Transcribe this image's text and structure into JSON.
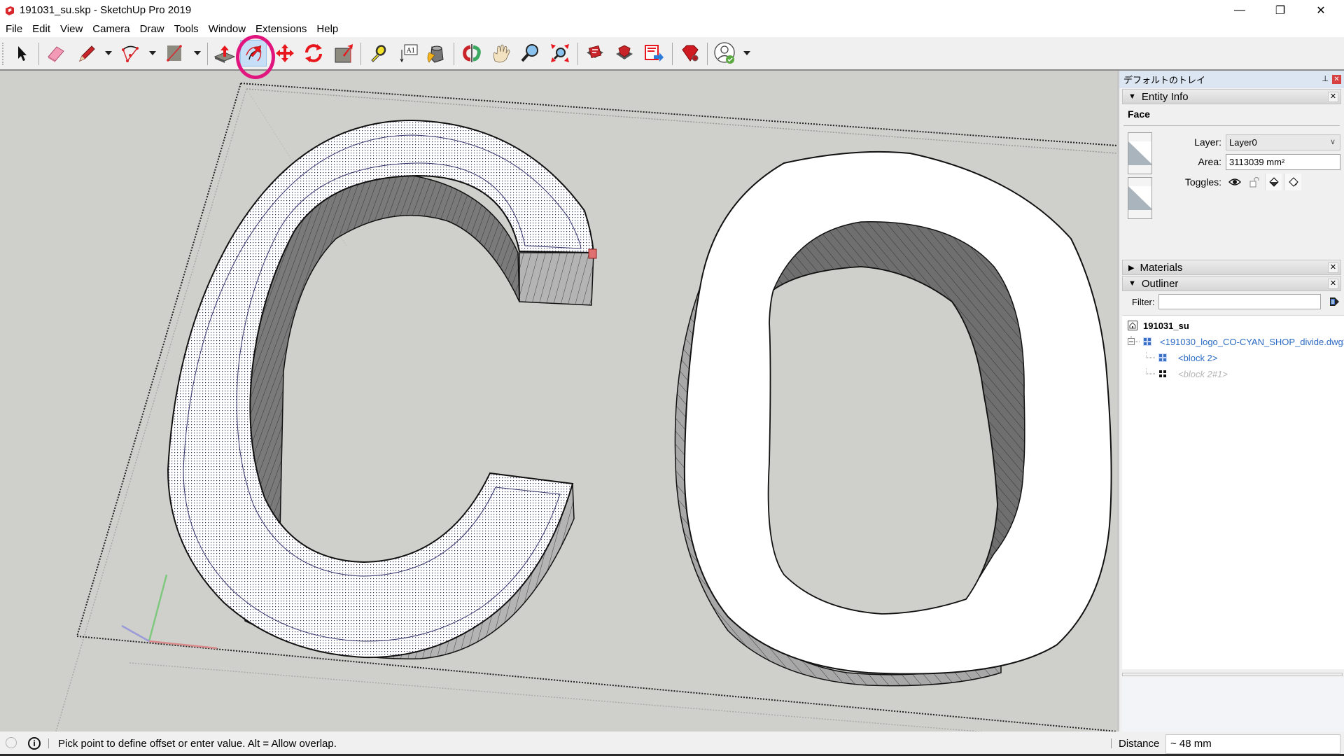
{
  "window": {
    "title": "191031_su.skp - SketchUp Pro 2019",
    "app_icon": "sketchup-logo-icon",
    "controls": {
      "minimize": "—",
      "restore": "❐",
      "close": "✕"
    }
  },
  "menubar": {
    "items": [
      "File",
      "Edit",
      "View",
      "Camera",
      "Draw",
      "Tools",
      "Window",
      "Extensions",
      "Help"
    ]
  },
  "toolbar": {
    "tools": [
      {
        "name": "select",
        "icon": "select-arrow-icon"
      },
      {
        "name": "eraser",
        "icon": "eraser-icon"
      },
      {
        "name": "line",
        "icon": "pencil-icon",
        "dropdown": true
      },
      {
        "name": "arc",
        "icon": "arc-icon",
        "dropdown": true
      },
      {
        "name": "rectangle",
        "icon": "rectangle-icon",
        "dropdown": true
      },
      {
        "name": "push-pull",
        "icon": "push-pull-icon"
      },
      {
        "name": "offset",
        "icon": "offset-icon",
        "active": true
      },
      {
        "name": "move",
        "icon": "move-icon"
      },
      {
        "name": "rotate",
        "icon": "rotate-icon"
      },
      {
        "name": "scale",
        "icon": "scale-icon"
      },
      {
        "name": "tape-measure",
        "icon": "tape-measure-icon"
      },
      {
        "name": "text",
        "icon": "text-icon",
        "glyph": "A1"
      },
      {
        "name": "paint-bucket",
        "icon": "paint-bucket-icon"
      },
      {
        "name": "orbit",
        "icon": "orbit-icon"
      },
      {
        "name": "pan",
        "icon": "pan-hand-icon"
      },
      {
        "name": "zoom",
        "icon": "zoom-icon"
      },
      {
        "name": "zoom-extents",
        "icon": "zoom-extents-icon"
      },
      {
        "name": "3d-warehouse",
        "icon": "warehouse-icon"
      },
      {
        "name": "extension-warehouse",
        "icon": "extension-warehouse-icon"
      },
      {
        "name": "share-model",
        "icon": "share-model-icon"
      },
      {
        "name": "extension-manager",
        "icon": "ruby-gear-icon"
      },
      {
        "name": "account",
        "icon": "account-user-icon",
        "dropdown": true
      }
    ],
    "highlight_color": "#e0167e"
  },
  "viewport": {
    "background": "#cfcfcb",
    "letters": [
      "C",
      "O"
    ],
    "selected_face": "C top face",
    "axes_colors": {
      "red": "#d98a8a",
      "green": "#7fc97f",
      "blue": "#9b9bd9"
    }
  },
  "tray": {
    "title": "デフォルトのトレイ",
    "pin_icon": "pin-icon",
    "close_icon": "close-icon",
    "entity_info": {
      "header": "Entity Info",
      "entity_type": "Face",
      "layer_label": "Layer:",
      "layer_value": "Layer0",
      "area_label": "Area:",
      "area_value": "3113039 mm²",
      "toggles_label": "Toggles:",
      "toggles": [
        "visibility-eye-icon",
        "lock-icon",
        "cast-shadows-icon",
        "receive-shadows-icon"
      ]
    },
    "materials": {
      "header": "Materials",
      "expanded": false
    },
    "outliner": {
      "header": "Outliner",
      "filter_label": "Filter:",
      "filter_value": "",
      "tree": [
        {
          "label": "191031_su",
          "icon": "model-house-icon",
          "level": 0
        },
        {
          "label": "<191030_logo_CO-CYAN_SHOP_divide.dwg>",
          "icon": "component-icon",
          "level": 1,
          "expanded": true
        },
        {
          "label": "<block 2>",
          "icon": "component-icon",
          "level": 2
        },
        {
          "label": "<block 2#1>",
          "icon": "component-hidden-icon",
          "level": 2,
          "hidden": true
        }
      ]
    }
  },
  "statusbar": {
    "message": "Pick point to define offset or enter value. Alt = Allow overlap.",
    "vcb_label": "Distance",
    "vcb_value": "~ 48 mm"
  }
}
